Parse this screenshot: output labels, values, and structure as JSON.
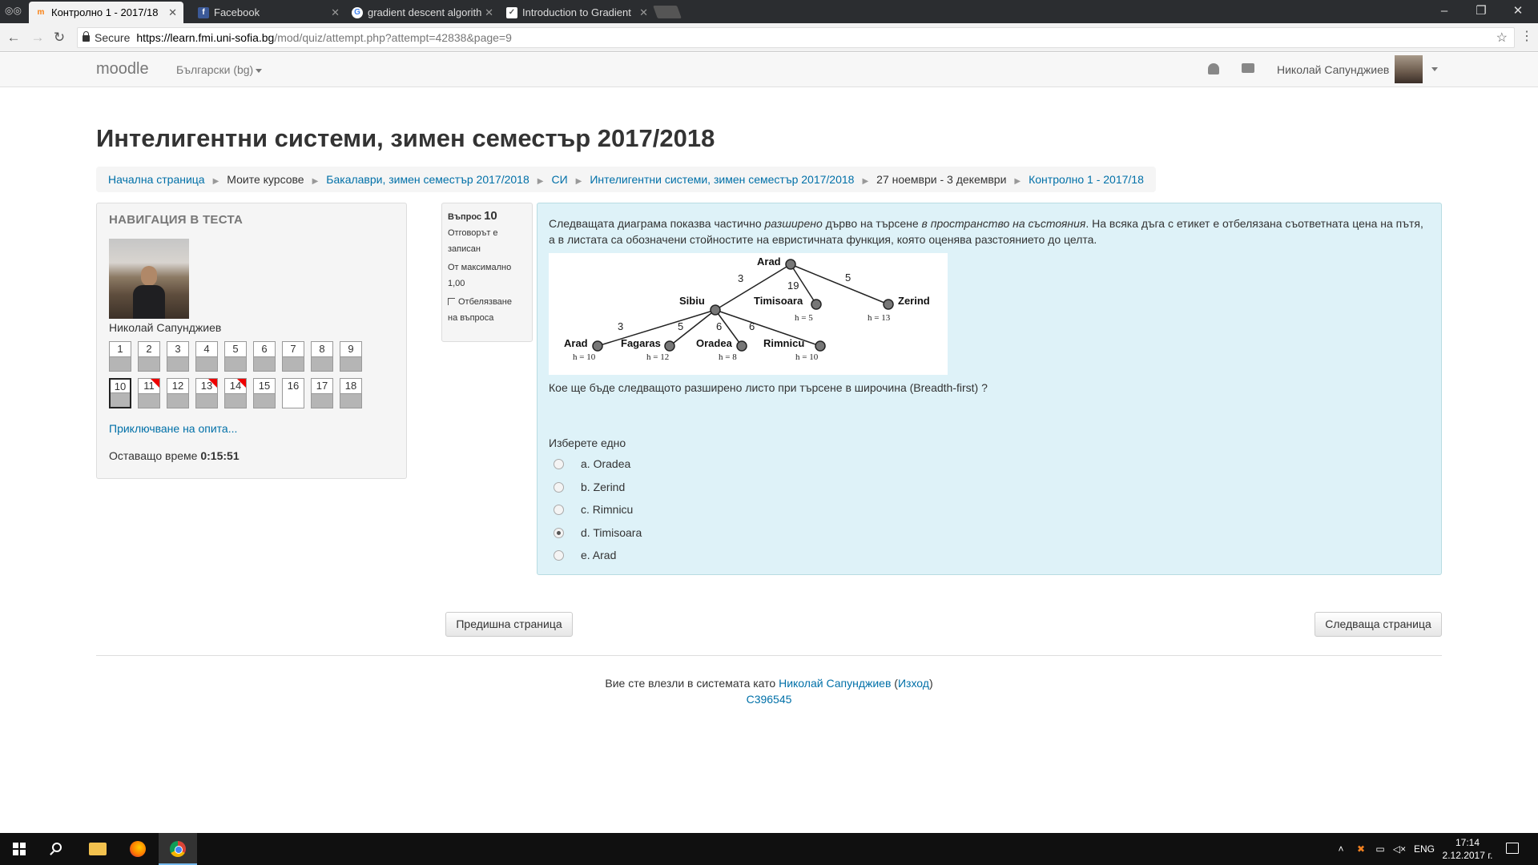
{
  "browser": {
    "tabs": [
      {
        "title": "Контролно 1 - 2017/18",
        "favicon": "moodle-icon",
        "active": true
      },
      {
        "title": "Facebook",
        "favicon": "facebook-icon",
        "active": false
      },
      {
        "title": "gradient descent algorith",
        "favicon": "google-icon",
        "active": false
      },
      {
        "title": "Introduction to Gradient",
        "favicon": "article-icon",
        "active": false
      }
    ],
    "secure_label": "Secure",
    "url_host": "https://learn.fmi.uni-sofia.bg",
    "url_path": "/mod/quiz/attempt.php?attempt=42838&page=9"
  },
  "navbar": {
    "brand": "moodle",
    "language": "Български (bg)",
    "user_name": "Николай Сапунджиев"
  },
  "page_title": "Интелигентни системи, зимен семестър 2017/2018",
  "breadcrumb": [
    {
      "label": "Начална страница",
      "link": true
    },
    {
      "label": "Моите курсове",
      "link": false
    },
    {
      "label": "Бакалаври, зимен семестър 2017/2018",
      "link": true
    },
    {
      "label": "СИ",
      "link": true
    },
    {
      "label": "Интелигентни системи, зимен семестър 2017/2018",
      "link": true
    },
    {
      "label": "27 ноември - 3 декември",
      "link": false
    },
    {
      "label": "Контролно 1 - 2017/18",
      "link": true
    }
  ],
  "quiz_nav": {
    "heading": "НАВИГАЦИЯ В ТЕСТА",
    "user_name": "Николай Сапунджиев",
    "questions": [
      {
        "n": "1",
        "answered": true,
        "flagged": false,
        "current": false
      },
      {
        "n": "2",
        "answered": true,
        "flagged": false,
        "current": false
      },
      {
        "n": "3",
        "answered": true,
        "flagged": false,
        "current": false
      },
      {
        "n": "4",
        "answered": true,
        "flagged": false,
        "current": false
      },
      {
        "n": "5",
        "answered": true,
        "flagged": false,
        "current": false
      },
      {
        "n": "6",
        "answered": true,
        "flagged": false,
        "current": false
      },
      {
        "n": "7",
        "answered": true,
        "flagged": false,
        "current": false
      },
      {
        "n": "8",
        "answered": true,
        "flagged": false,
        "current": false
      },
      {
        "n": "9",
        "answered": true,
        "flagged": false,
        "current": false
      },
      {
        "n": "10",
        "answered": true,
        "flagged": false,
        "current": true
      },
      {
        "n": "11",
        "answered": true,
        "flagged": true,
        "current": false
      },
      {
        "n": "12",
        "answered": true,
        "flagged": false,
        "current": false
      },
      {
        "n": "13",
        "answered": true,
        "flagged": true,
        "current": false
      },
      {
        "n": "14",
        "answered": true,
        "flagged": true,
        "current": false
      },
      {
        "n": "15",
        "answered": true,
        "flagged": false,
        "current": false
      },
      {
        "n": "16",
        "answered": false,
        "flagged": false,
        "current": false
      },
      {
        "n": "17",
        "answered": true,
        "flagged": false,
        "current": false
      },
      {
        "n": "18",
        "answered": true,
        "flagged": false,
        "current": false
      }
    ],
    "finish_link": "Приключване на опита...",
    "time_left_label": "Оставащо време",
    "time_left": "0:15:51"
  },
  "question_info": {
    "label": "Въпрос",
    "number": "10",
    "state_1": "Отговорът е",
    "state_2": "записан",
    "marks_1": "От максимално",
    "marks_2": "1,00",
    "flag_1": "Отбелязване",
    "flag_2": "на въпроса"
  },
  "question": {
    "text_1": "Следващата диаграма показва частично ",
    "text_2": "разширено",
    "text_3": " дърво на търсене ",
    "text_4": "в пространство на състояния",
    "text_5": ". На всяка дъга с етикет е отбелязана съответната цена на пътя, а в листата са обозначени стойностите на евристичната функция, която оценява разстоянието до целта.",
    "tree": {
      "nodes": {
        "arad_root": "Arad",
        "sibiu": "Sibiu",
        "timisoara": "Timisoara",
        "zerind": "Zerind",
        "arad_leaf": "Arad",
        "fagaras": "Fagaras",
        "oradea": "Oradea",
        "rimnicu": "Rimnicu"
      },
      "edges": {
        "arad_sibiu": "3",
        "arad_timisoara": "19",
        "arad_zerind": "5",
        "sibiu_arad": "3",
        "sibiu_fagaras": "5",
        "sibiu_oradea": "6",
        "sibiu_rimnicu": "6"
      },
      "heuristics": {
        "timisoara": "h = 5",
        "zerind": "h = 13",
        "arad_leaf": "h = 10",
        "fagaras": "h = 12",
        "oradea": "h = 8",
        "rimnicu": "h = 10"
      }
    },
    "prompt": "Кое ще бъде следващото разширено листо при търсене в широчина (Breadth-first) ?",
    "choose_label": "Изберете едно",
    "options": [
      {
        "label": "a. Oradea",
        "selected": false
      },
      {
        "label": "b. Zerind",
        "selected": false
      },
      {
        "label": "c. Rimnicu",
        "selected": false
      },
      {
        "label": "d. Timisoara",
        "selected": true
      },
      {
        "label": "e. Arad",
        "selected": false
      }
    ]
  },
  "buttons": {
    "prev": "Предишна страница",
    "next": "Следваща страница"
  },
  "footer": {
    "logged_in_as": "Вие сте влезли в системата като",
    "user": "Николай Сапунджиев",
    "logout_open": "(",
    "logout": "Изход",
    "logout_close": ")",
    "code": "C396545"
  },
  "taskbar": {
    "language": "ENG",
    "time": "17:14",
    "date": "2.12.2017 г."
  },
  "colors": {
    "link": "#0070a8",
    "question_bg": "#def2f8",
    "flag": "#e00000"
  }
}
